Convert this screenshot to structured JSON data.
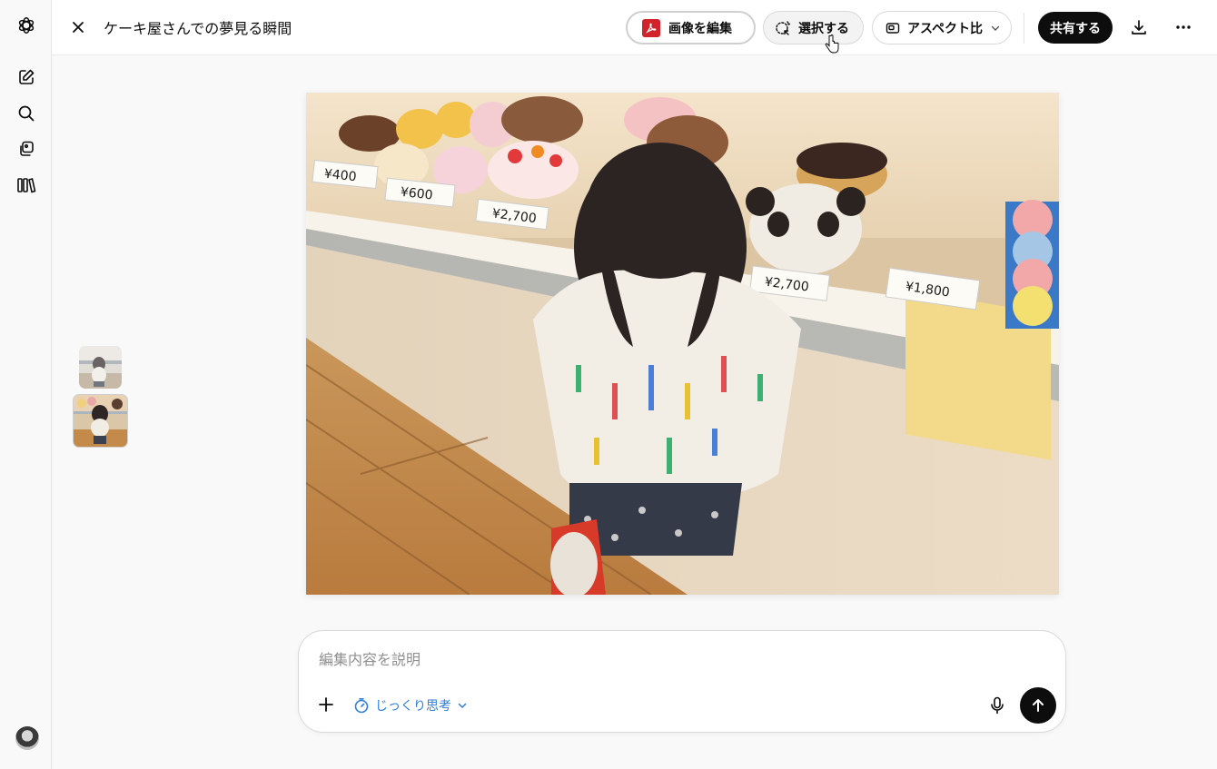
{
  "header": {
    "title": "ケーキ屋さんでの夢見る瞬間",
    "edit_image_label": "画像を編集",
    "select_label": "選択する",
    "aspect_label": "アスペクト比",
    "share_label": "共有する"
  },
  "composer": {
    "placeholder": "編集内容を説明",
    "think_label": "じっくり思考"
  },
  "colors": {
    "accent_blue": "#2f7ed8",
    "pdf_red": "#d1232a",
    "primary_black": "#0d0d0d"
  },
  "image": {
    "price_tags": [
      "¥400",
      "¥600",
      "¥2,700",
      "¥2,700",
      "¥1,800"
    ]
  },
  "icons": {
    "sidebar": [
      "openai-logo-icon",
      "new-chat-icon",
      "search-icon",
      "library-icon",
      "library-books-icon"
    ],
    "toolbar": [
      "close-icon",
      "pdf-icon",
      "select-icon",
      "aspect-ratio-icon",
      "chevron-down-icon",
      "download-icon",
      "more-icon"
    ],
    "composer": [
      "plus-icon",
      "think-icon",
      "chevron-down-icon",
      "mic-icon",
      "send-arrow-icon"
    ]
  }
}
